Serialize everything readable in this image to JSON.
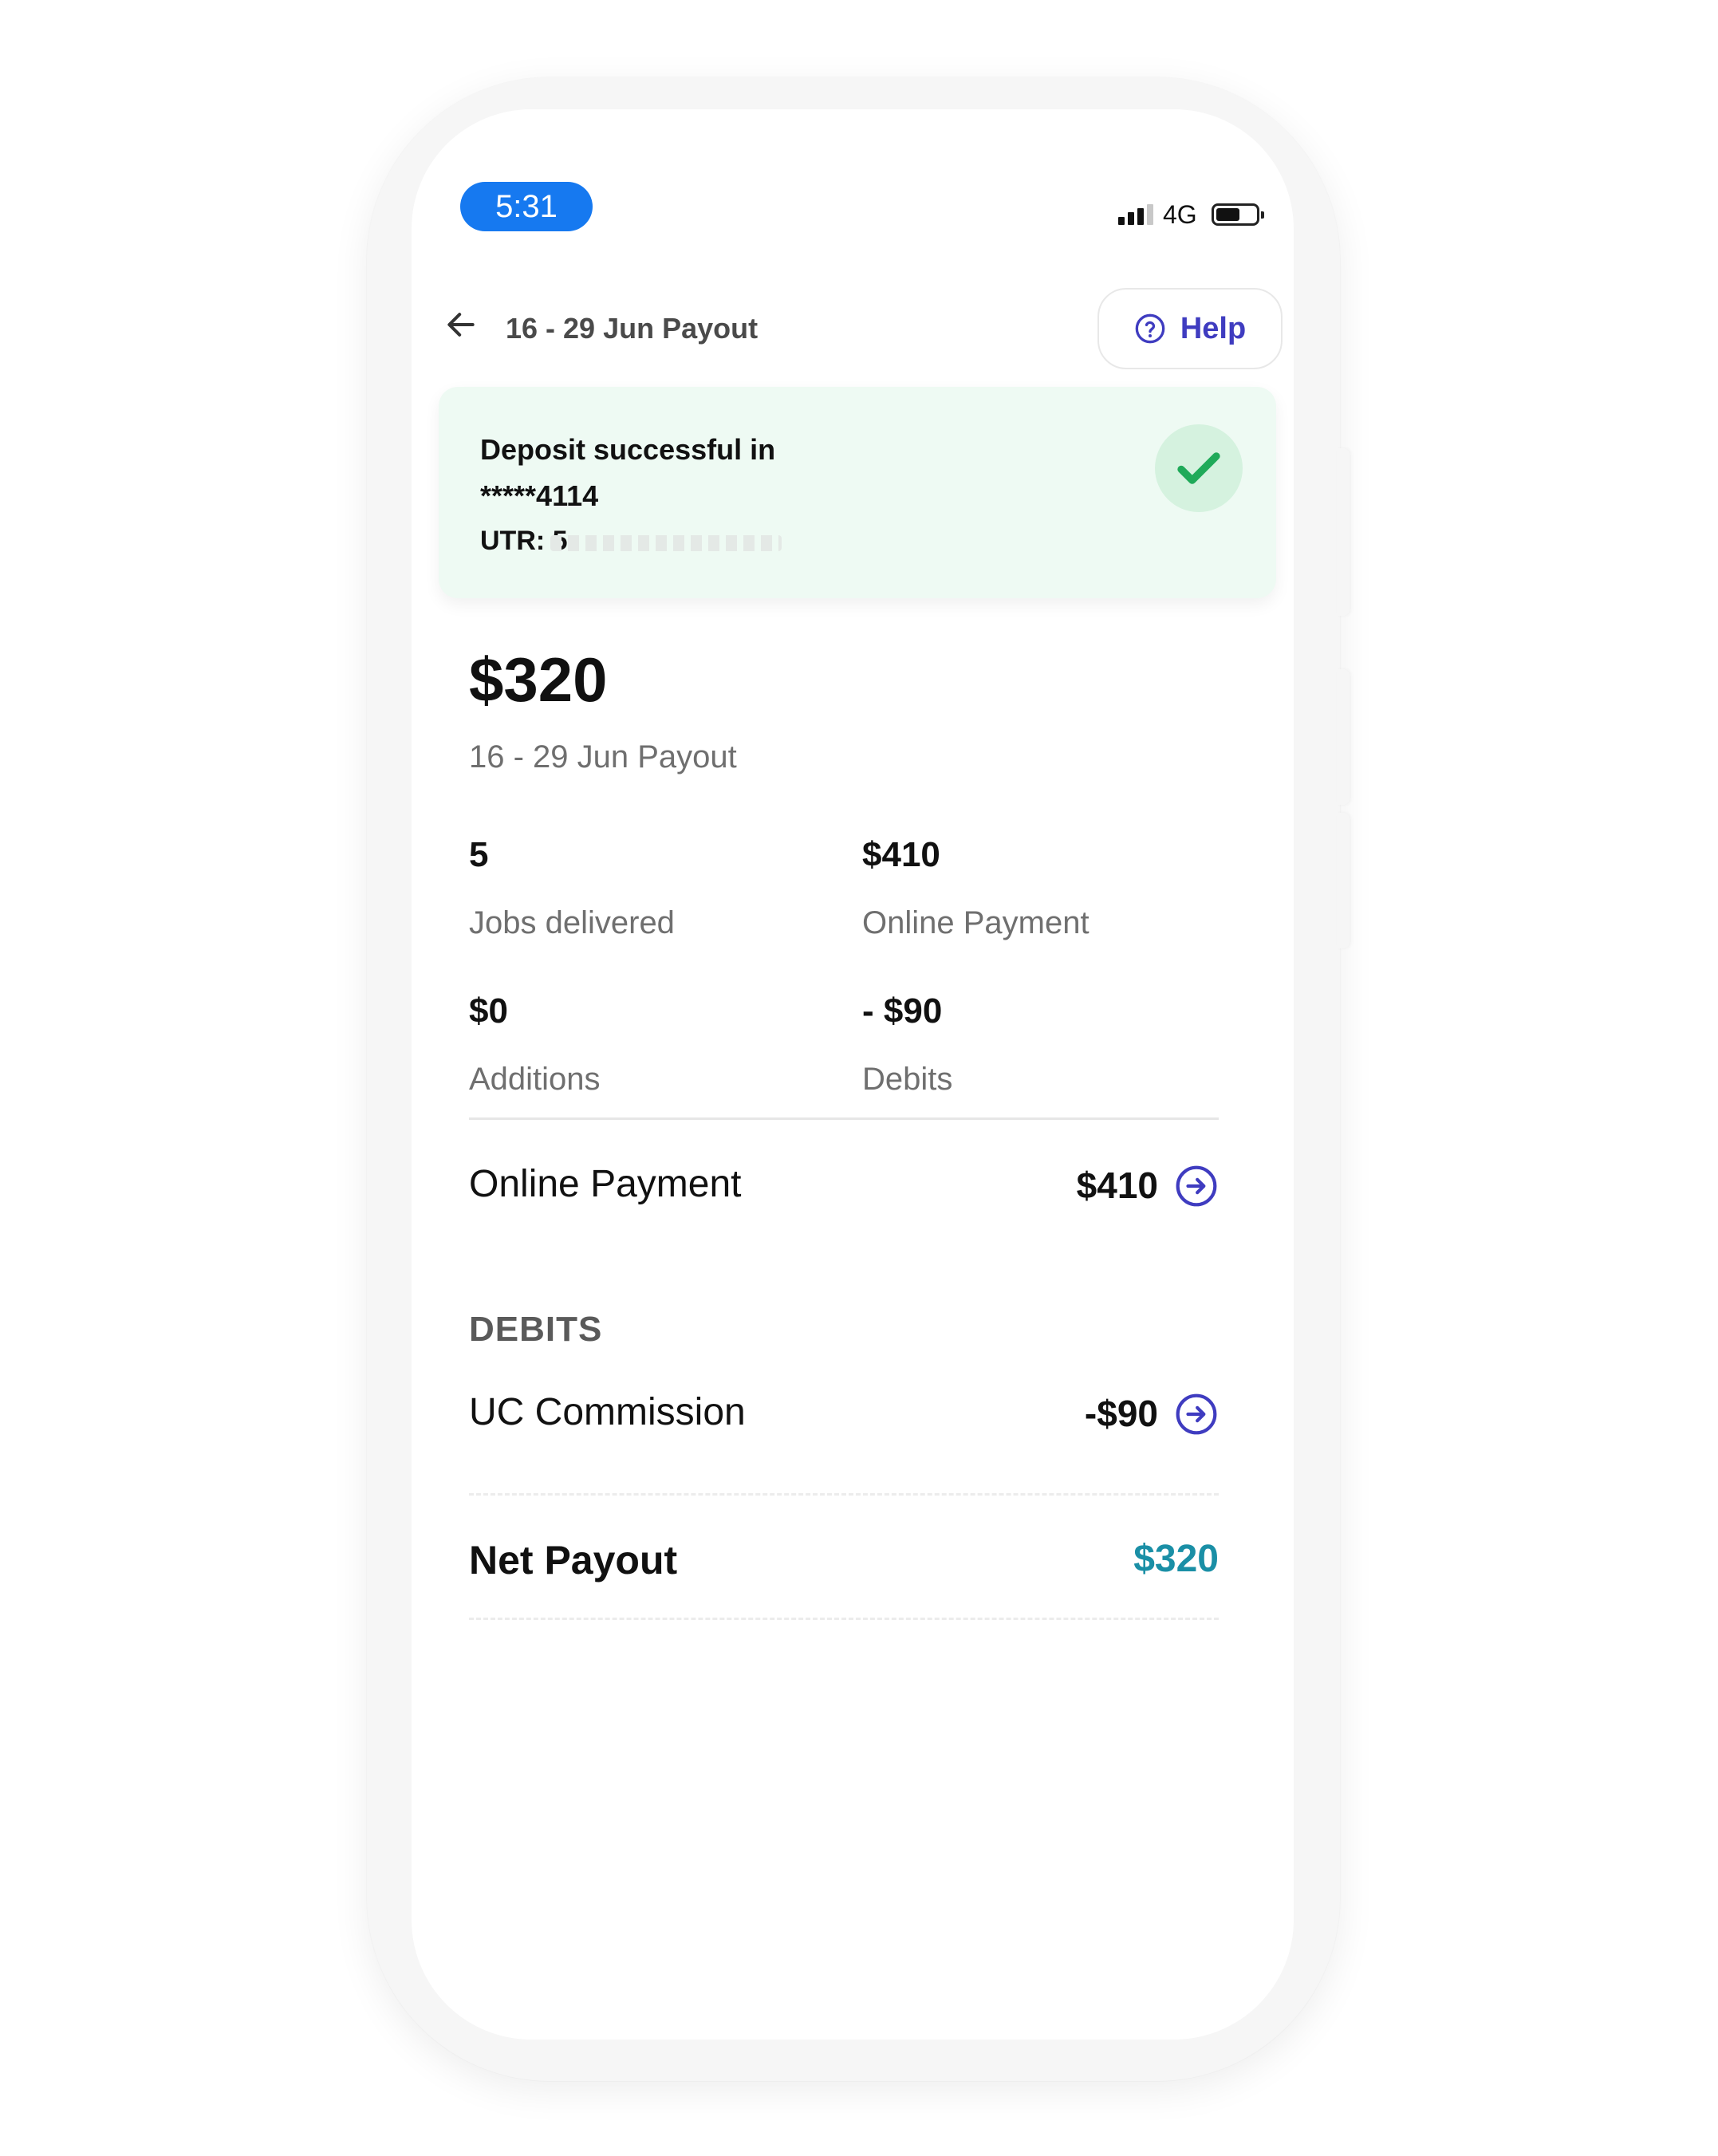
{
  "status_bar": {
    "time": "5:31",
    "network": "4G"
  },
  "header": {
    "title": "16 - 29 Jun Payout",
    "help_label": "Help"
  },
  "deposit": {
    "message": "Deposit successful in *****4114",
    "utr_label": "UTR: 5"
  },
  "summary": {
    "amount": "$320",
    "period": "16 - 29 Jun Payout",
    "stats": [
      {
        "value": "5",
        "label": "Jobs delivered"
      },
      {
        "value": "$410",
        "label": "Online Payment"
      },
      {
        "value": "$0",
        "label": "Additions"
      },
      {
        "value": "- $90",
        "label": "Debits"
      }
    ]
  },
  "online_payment": {
    "label": "Online Payment",
    "amount": "$410"
  },
  "debits": {
    "section_title": "DEBITS",
    "items": [
      {
        "label": "UC Commission",
        "amount": "-$90"
      }
    ]
  },
  "net_payout": {
    "label": "Net Payout",
    "amount": "$320"
  },
  "colors": {
    "accent": "#3f3cc0",
    "time_pill": "#1679f0",
    "success_bg": "#eefaf3",
    "success_check": "#1faa59",
    "net_amount": "#1a8fa6"
  }
}
